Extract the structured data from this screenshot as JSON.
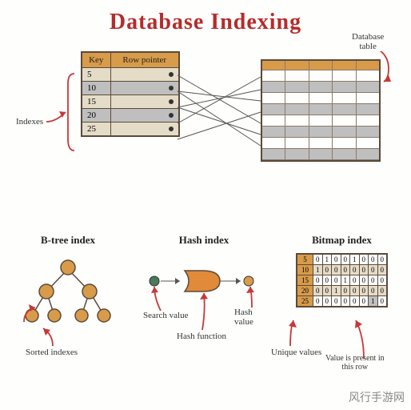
{
  "title": "Database Indexing",
  "index_table": {
    "headers": [
      "Key",
      "Row pointer"
    ],
    "rows": [
      {
        "key": "5",
        "hl": false
      },
      {
        "key": "10",
        "hl": true
      },
      {
        "key": "15",
        "hl": false
      },
      {
        "key": "20",
        "hl": true
      },
      {
        "key": "25",
        "hl": false
      }
    ]
  },
  "labels": {
    "indexes": "Indexes",
    "dbtable": "Database\ntable"
  },
  "btree": {
    "title": "B-tree index",
    "annot": "Sorted indexes"
  },
  "hash": {
    "title": "Hash index",
    "annot_sv": "Search value",
    "annot_hf": "Hash function",
    "annot_hv": "Hash value"
  },
  "bitmap": {
    "title": "Bitmap index",
    "annot_uv": "Unique values",
    "annot_vp": "Value is present in\nthis row",
    "rows": [
      {
        "k": "5",
        "bits": [
          "0",
          "1",
          "0",
          "0",
          "1",
          "0",
          "0",
          "0"
        ]
      },
      {
        "k": "10",
        "bits": [
          "1",
          "0",
          "0",
          "0",
          "0",
          "0",
          "0",
          "0"
        ]
      },
      {
        "k": "15",
        "bits": [
          "0",
          "0",
          "0",
          "1",
          "0",
          "0",
          "0",
          "0"
        ]
      },
      {
        "k": "20",
        "bits": [
          "0",
          "0",
          "1",
          "0",
          "0",
          "0",
          "0",
          "0"
        ]
      },
      {
        "k": "25",
        "bits": [
          "0",
          "0",
          "0",
          "0",
          "0",
          "0",
          "1",
          "0"
        ]
      }
    ]
  },
  "watermark": "风行手游网"
}
